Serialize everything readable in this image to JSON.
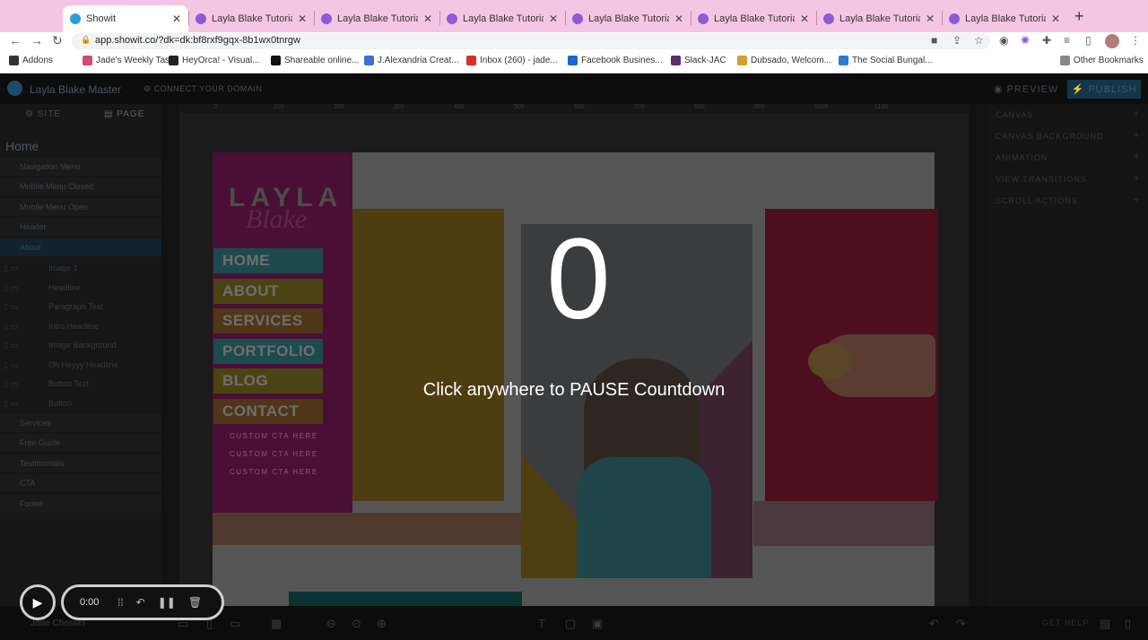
{
  "browser": {
    "tabs": [
      {
        "title": "Showit",
        "active": true,
        "favicon_color": "#2a9fd6"
      },
      {
        "title": "Layla Blake Tutorials |",
        "active": false,
        "favicon_color": "#8a5cd6"
      },
      {
        "title": "Layla Blake Tutorials |",
        "active": false,
        "favicon_color": "#8a5cd6"
      },
      {
        "title": "Layla Blake Tutorials |",
        "active": false,
        "favicon_color": "#8a5cd6"
      },
      {
        "title": "Layla Blake Tutorials |",
        "active": false,
        "favicon_color": "#8a5cd6"
      },
      {
        "title": "Layla Blake Tutorials |",
        "active": false,
        "favicon_color": "#8a5cd6"
      },
      {
        "title": "Layla Blake Tutorials |",
        "active": false,
        "favicon_color": "#8a5cd6"
      },
      {
        "title": "Layla Blake Tutorials |",
        "active": false,
        "favicon_color": "#8a5cd6"
      }
    ],
    "tab_close": "✕",
    "new_tab": "+",
    "back": "←",
    "forward": "→",
    "reload": "↻",
    "url": "app.showit.co/?dk=dk:bf8rxf9gqx-8b1wx0tnrgw",
    "bookmarks": [
      {
        "label": "Addons",
        "color": "#333"
      },
      {
        "label": "Jade's Weekly Tas...",
        "color": "#d04a7a"
      },
      {
        "label": "HeyOrca! - Visual...",
        "color": "#222"
      },
      {
        "label": "Shareable online...",
        "color": "#111"
      },
      {
        "label": "J.Alexandria Creat...",
        "color": "#3b6fd1"
      },
      {
        "label": "Inbox (260) - jade...",
        "color": "#d93025"
      },
      {
        "label": "Facebook Busines...",
        "color": "#1a64d6"
      },
      {
        "label": "Slack-JAC",
        "color": "#5a2d6b"
      },
      {
        "label": "Dubsado, Welcom...",
        "color": "#d6a02a"
      },
      {
        "label": "The Social Bungal...",
        "color": "#2a7ad6"
      }
    ],
    "other_bookmarks": "Other Bookmarks"
  },
  "app": {
    "title": "Layla Blake Master",
    "connect_domain": "CONNECT YOUR DOMAIN",
    "preview": "PREVIEW",
    "publish": "PUBLISH",
    "sidebar_tabs": {
      "site": "SITE",
      "page": "PAGE"
    },
    "page_name": "Home",
    "canvases": [
      "Navigation Menu",
      "Mobile Menu Closed",
      "Mobile Menu Open",
      "Header",
      "About"
    ],
    "about_children": [
      "Image 1",
      "Headline",
      "Paragraph Text",
      "Intro Headline",
      "Image Background",
      "Oh Heyyy Headline",
      "Button Text",
      "Button"
    ],
    "canvases_after": [
      "Services",
      "Free Guide",
      "Testimonials",
      "CTA",
      "Footer"
    ],
    "ruler_marks": [
      "0",
      "100",
      "200",
      "300",
      "400",
      "500",
      "600",
      "700",
      "800",
      "900",
      "1000",
      "1100"
    ],
    "right_panel": [
      "CANVAS",
      "CANVAS BACKGROUND",
      "ANIMATION",
      "VIEW TRANSITIONS",
      "SCROLL ACTIONS"
    ],
    "user": "Jade Chesser",
    "get_help": "GET HELP"
  },
  "page_content": {
    "logo_top": "LAYLA",
    "logo_script": "Blake",
    "menu": [
      {
        "label": "HOME",
        "color": "#1d4a4c"
      },
      {
        "label": "ABOUT",
        "color": "#4c4315"
      },
      {
        "label": "SERVICES",
        "color": "#4f3618"
      },
      {
        "label": "PORTFOLIO",
        "color": "#1d4a4c"
      },
      {
        "label": "BLOG",
        "color": "#4c4315"
      },
      {
        "label": "CONTACT",
        "color": "#4f3618"
      }
    ],
    "ctas": [
      "CUSTOM CTA HERE",
      "CUSTOM CTA HERE",
      "CUSTOM CTA HERE"
    ]
  },
  "overlay": {
    "countdown": "0",
    "message": "Click anywhere to PAUSE Countdown"
  },
  "recorder": {
    "time": "0:00"
  }
}
